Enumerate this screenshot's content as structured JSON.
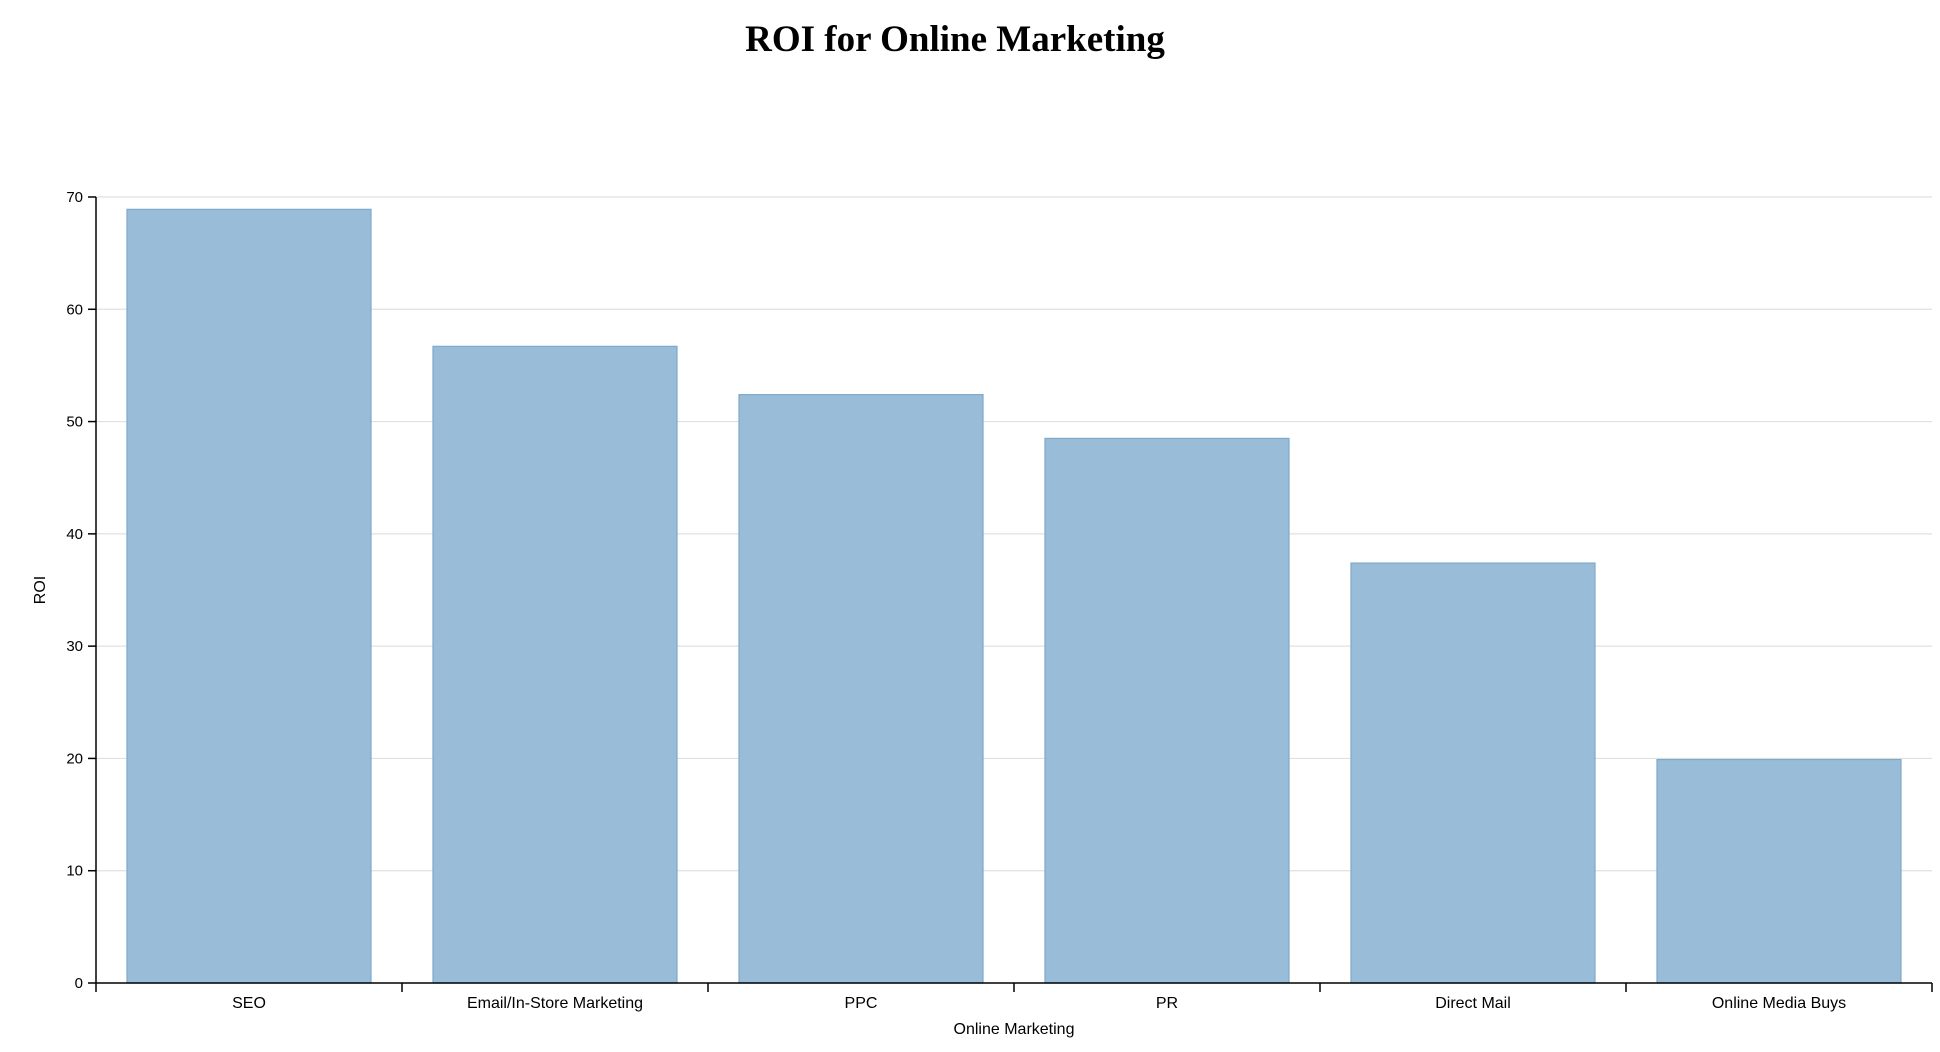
{
  "chart_data": {
    "type": "bar",
    "title": "ROI for Online Marketing",
    "xlabel": "Online Marketing",
    "ylabel": "ROI",
    "categories": [
      "SEO",
      "Email/In-Store Marketing",
      "PPC",
      "PR",
      "Direct Mail",
      "Online Media Buys"
    ],
    "values": [
      68.9,
      56.7,
      52.4,
      48.5,
      37.4,
      19.9
    ],
    "ylim": [
      0,
      70
    ],
    "yticks": [
      0,
      10,
      20,
      30,
      40,
      50,
      60,
      70
    ],
    "grid": true,
    "legend": "none",
    "colors": {
      "bar_fill": "#99bdd9",
      "bar_stroke": "#7fa8c9",
      "grid": "#e0e0e0",
      "axis": "#000000"
    }
  }
}
